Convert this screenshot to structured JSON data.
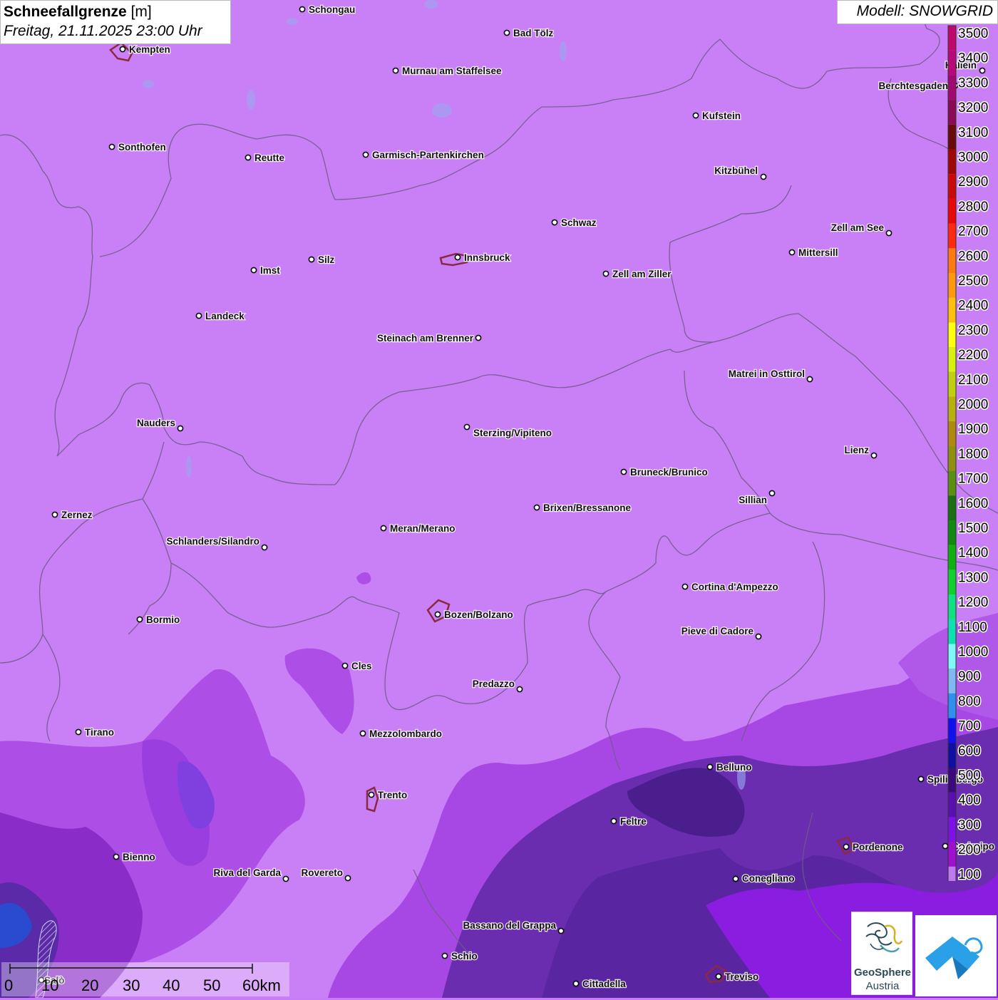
{
  "header": {
    "title": "Schneefallgrenze",
    "unit": "[m]",
    "datetime": "Freitag, 21.11.2025 23:00 Uhr",
    "model": "Modell: SNOWGRID"
  },
  "legend": {
    "entries": [
      {
        "label": "3500",
        "color": "#c0086c"
      },
      {
        "label": "3400",
        "color": "#b8087a"
      },
      {
        "label": "3300",
        "color": "#a00a70"
      },
      {
        "label": "3200",
        "color": "#8a0a55"
      },
      {
        "label": "3100",
        "color": "#6a0a0a"
      },
      {
        "label": "3000",
        "color": "#a00808"
      },
      {
        "label": "2900",
        "color": "#c80a0a"
      },
      {
        "label": "2800",
        "color": "#e80808"
      },
      {
        "label": "2700",
        "color": "#ff2a10"
      },
      {
        "label": "2600",
        "color": "#ff7a10"
      },
      {
        "label": "2500",
        "color": "#ff9a10"
      },
      {
        "label": "2400",
        "color": "#ffc010"
      },
      {
        "label": "2300",
        "color": "#ffff10"
      },
      {
        "label": "2200",
        "color": "#d8f010"
      },
      {
        "label": "2100",
        "color": "#c0d010"
      },
      {
        "label": "2000",
        "color": "#b8b010"
      },
      {
        "label": "1900",
        "color": "#b08a10"
      },
      {
        "label": "1800",
        "color": "#909010"
      },
      {
        "label": "1700",
        "color": "#5a9010"
      },
      {
        "label": "1600",
        "color": "#1a7010"
      },
      {
        "label": "1500",
        "color": "#108a10"
      },
      {
        "label": "1400",
        "color": "#10b010"
      },
      {
        "label": "1300",
        "color": "#10d030"
      },
      {
        "label": "1200",
        "color": "#10e080"
      },
      {
        "label": "1100",
        "color": "#10e0b0"
      },
      {
        "label": "1000",
        "color": "#80f8f8"
      },
      {
        "label": "900",
        "color": "#80b8f0"
      },
      {
        "label": "800",
        "color": "#3090f0"
      },
      {
        "label": "700",
        "color": "#1010f0"
      },
      {
        "label": "600",
        "color": "#1010a0"
      },
      {
        "label": "500",
        "color": "#3a0a7a"
      },
      {
        "label": "400",
        "color": "#5a10b0"
      },
      {
        "label": "300",
        "color": "#8010e8"
      },
      {
        "label": "200",
        "color": "#a010d0"
      },
      {
        "label": "100",
        "color": "#c07af0"
      }
    ]
  },
  "cities": [
    {
      "name": "Schongau"
    },
    {
      "name": "Bad Tölz"
    },
    {
      "name": "Kempten"
    },
    {
      "name": "Murnau am Staffelsee"
    },
    {
      "name": "Hallein"
    },
    {
      "name": "Berchtesgaden"
    },
    {
      "name": "Kufstein"
    },
    {
      "name": "Sonthofen"
    },
    {
      "name": "Reutte"
    },
    {
      "name": "Garmisch-Partenkirchen"
    },
    {
      "name": "Kitzbühel"
    },
    {
      "name": "Schwaz"
    },
    {
      "name": "Zell am See"
    },
    {
      "name": "Mittersill"
    },
    {
      "name": "Innsbruck"
    },
    {
      "name": "Silz"
    },
    {
      "name": "Imst"
    },
    {
      "name": "Zell am Ziller"
    },
    {
      "name": "Landeck"
    },
    {
      "name": "Steinach am Brenner"
    },
    {
      "name": "Matrei in Osttirol"
    },
    {
      "name": "Nauders"
    },
    {
      "name": "Sterzing/Vipiteno"
    },
    {
      "name": "Lienz"
    },
    {
      "name": "Bruneck/Brunico"
    },
    {
      "name": "Sillian"
    },
    {
      "name": "Brixen/Bressanone"
    },
    {
      "name": "Zernez"
    },
    {
      "name": "Meran/Merano"
    },
    {
      "name": "Schlanders/Silandro"
    },
    {
      "name": "Cortina d'Ampezzo"
    },
    {
      "name": "Bozen/Bolzano"
    },
    {
      "name": "Bormio"
    },
    {
      "name": "Pieve di Cadore"
    },
    {
      "name": "Cles"
    },
    {
      "name": "Predazzo"
    },
    {
      "name": "Tirano"
    },
    {
      "name": "Mezzolombardo"
    },
    {
      "name": "Belluno"
    },
    {
      "name": "Spilimbergo"
    },
    {
      "name": "Trento"
    },
    {
      "name": "Feltre"
    },
    {
      "name": "Pordenone"
    },
    {
      "name": "Codroipo"
    },
    {
      "name": "Bienno"
    },
    {
      "name": "Riva del Garda"
    },
    {
      "name": "Rovereto"
    },
    {
      "name": "Conegliano"
    },
    {
      "name": "Bassano del Grappa"
    },
    {
      "name": "Schio"
    },
    {
      "name": "Treviso"
    },
    {
      "name": "Cittadella"
    },
    {
      "name": "Salò"
    }
  ],
  "scale_bar": {
    "labels": [
      "0",
      "10",
      "20",
      "30",
      "40",
      "50",
      "60km"
    ]
  },
  "logos": {
    "geosphere_line1": "GeoSphere",
    "geosphere_line2": "Austria"
  }
}
